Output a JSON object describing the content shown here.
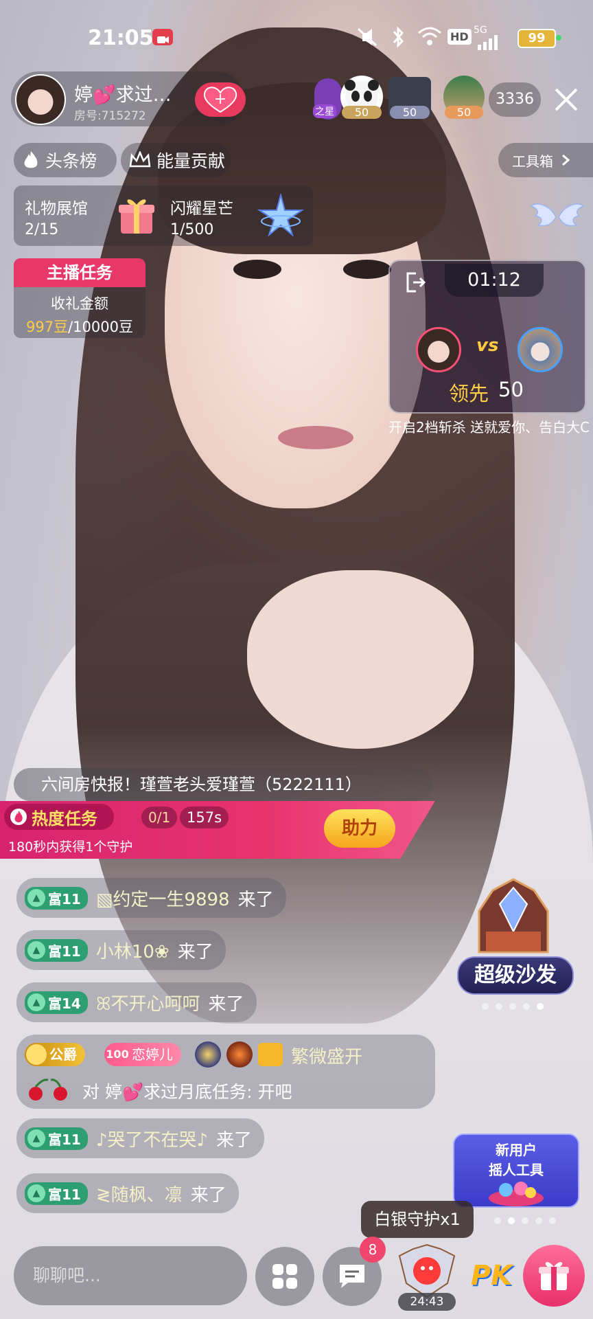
{
  "status": {
    "time": "21:05",
    "network": "5G",
    "battery": "99",
    "hd": "HD"
  },
  "host": {
    "name": "婷💕求过…",
    "room_id": "房号:715272"
  },
  "viewers": {
    "badges": [
      "之星",
      "50",
      "50",
      "50"
    ],
    "count": "3336"
  },
  "tabs": {
    "hot_list": "头条榜",
    "energy": "能量贡献",
    "toolbox": "工具箱"
  },
  "gift_hall": {
    "label": "礼物展馆",
    "progress": "2/15"
  },
  "shine_star": {
    "label": "闪耀星芒",
    "progress": "1/500"
  },
  "host_task": {
    "title": "主播任务",
    "subtitle": "收礼金额",
    "current": "997豆",
    "target": "/10000豆"
  },
  "pk": {
    "timer": "01:12",
    "vs": "vs",
    "lead_label": "领先",
    "lead_value": "50",
    "ticker": "开启2档斩杀   送就爱你、告白大C"
  },
  "announcement": "六间房快报！瑾萱老头爱瑾萱（5222111）",
  "heat_task": {
    "title": "热度任务",
    "progress": "0/1",
    "timer": "157s",
    "desc": "180秒内获得1个守护",
    "help_button": "助力"
  },
  "chat": [
    {
      "level": "富11",
      "user": "▧约定一生9898",
      "text": "来了"
    },
    {
      "level": "富11",
      "user": "小林10❀",
      "text": "来了"
    },
    {
      "level": "富14",
      "user": "ꕤ不开心呵呵",
      "text": "来了"
    },
    {
      "level": "富11",
      "user": "♪哭了不在哭♪",
      "text": "来了"
    },
    {
      "level": "富11",
      "user": "≷随枫、凛",
      "text": "来了"
    }
  ],
  "duke_msg": {
    "rank": "公爵",
    "fan_level": "100",
    "fan_name": "恋婷儿",
    "user": "繁微盛开",
    "text": "对 婷💕求过月底任务: 开吧"
  },
  "super_sofa": "超级沙发",
  "new_user": {
    "line1": "新用户",
    "line2": "摇人工具"
  },
  "silver_guard": "白银守护x1",
  "input_placeholder": "聊聊吧...",
  "message_badge": "8",
  "guard_timer": "24:43",
  "pk_label": "PK"
}
